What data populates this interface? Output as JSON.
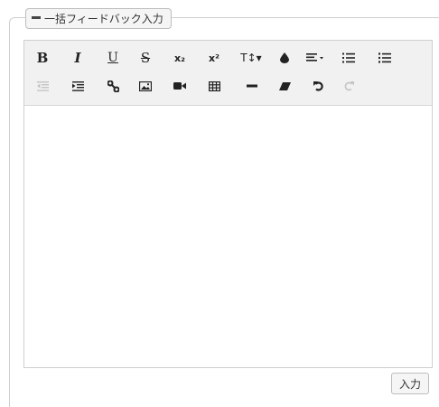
{
  "fieldset": {
    "legend_label": "一括フィードバック入力",
    "collapse_icon": "minus-icon"
  },
  "toolbar": {
    "row1": [
      {
        "name": "bold",
        "label": "B",
        "icon": "bold-icon"
      },
      {
        "name": "italic",
        "label": "I",
        "icon": "italic-icon"
      },
      {
        "name": "underline",
        "label": "U",
        "icon": "underline-icon"
      },
      {
        "name": "strikethrough",
        "label": "S",
        "icon": "strikethrough-icon"
      },
      {
        "name": "subscript",
        "label": "x₂",
        "icon": "subscript-icon"
      },
      {
        "name": "superscript",
        "label": "x²",
        "icon": "superscript-icon"
      },
      {
        "name": "font-size",
        "label": "T↕▾",
        "icon": "text-height-icon"
      },
      {
        "name": "color",
        "label": "",
        "icon": "tint-icon"
      },
      {
        "name": "align",
        "label": "",
        "icon": "align-left-dropdown-icon"
      },
      {
        "name": "ordered-list",
        "label": "",
        "icon": "ordered-list-icon"
      },
      {
        "name": "unordered-list",
        "label": "",
        "icon": "unordered-list-icon"
      }
    ],
    "row2": [
      {
        "name": "outdent",
        "label": "",
        "icon": "outdent-icon",
        "disabled": true
      },
      {
        "name": "indent",
        "label": "",
        "icon": "indent-icon"
      },
      {
        "name": "link",
        "label": "",
        "icon": "link-icon"
      },
      {
        "name": "image",
        "label": "",
        "icon": "picture-icon"
      },
      {
        "name": "video",
        "label": "",
        "icon": "video-camera-icon"
      },
      {
        "name": "table",
        "label": "",
        "icon": "table-icon"
      },
      {
        "name": "horizontal-rule",
        "label": "",
        "icon": "horizontal-rule-icon"
      },
      {
        "name": "eraser",
        "label": "",
        "icon": "eraser-icon"
      },
      {
        "name": "undo",
        "label": "",
        "icon": "undo-icon"
      },
      {
        "name": "redo",
        "label": "",
        "icon": "redo-icon",
        "disabled": true
      }
    ]
  },
  "editor": {
    "content": ""
  },
  "submit": {
    "label": "入力"
  }
}
